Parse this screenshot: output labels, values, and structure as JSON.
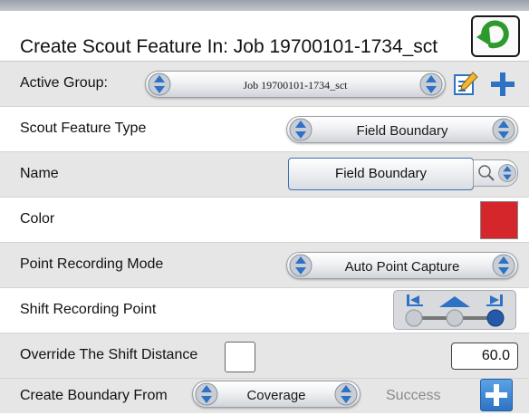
{
  "header": {
    "title": "Create Scout Feature In: Job 19700101-1734_sct",
    "back_icon": "return-arrow-icon"
  },
  "active_group": {
    "label": "Active Group:",
    "value": "Job 19700101-1734_sct"
  },
  "scout_feature_type": {
    "label": "Scout Feature Type",
    "value": "Field Boundary"
  },
  "name": {
    "label": "Name",
    "value": "Field Boundary"
  },
  "color": {
    "label": "Color",
    "value_color": "#d4262b"
  },
  "point_recording_mode": {
    "label": "Point Recording Mode",
    "value": "Auto Point Capture"
  },
  "shift_recording_point": {
    "label": "Shift Recording Point",
    "selected": "right"
  },
  "override_shift_distance": {
    "label": "Override The Shift Distance",
    "checked": false,
    "value": "60.0"
  },
  "create_boundary_from": {
    "label": "Create Boundary From",
    "value": "Coverage",
    "status": "Success"
  },
  "colors": {
    "accent_blue": "#2d72c4",
    "alt_row": "#e6e6e6",
    "back_green": "#2e9a2e"
  }
}
